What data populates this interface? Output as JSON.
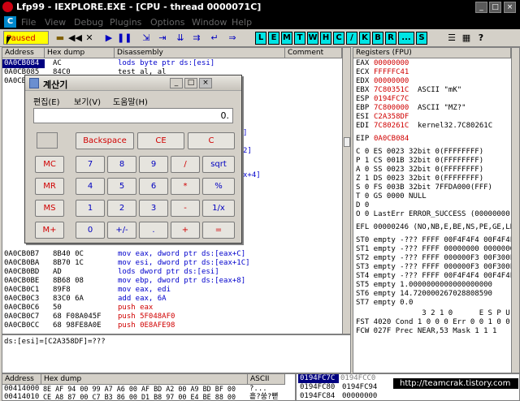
{
  "window": {
    "title": "Lfp99 - IEXPLORE.EXE - [CPU - thread 0000071C]",
    "min": "_",
    "max": "□",
    "close": "×"
  },
  "menu": [
    "File",
    "View",
    "Debug",
    "Plugins",
    "Options",
    "Window",
    "Help"
  ],
  "toolbar": {
    "status": "Paused",
    "letters": [
      "L",
      "E",
      "M",
      "T",
      "W",
      "H",
      "C",
      "/",
      "K",
      "B",
      "R",
      "...",
      "S"
    ]
  },
  "disasm": {
    "headers": [
      "Address",
      "Hex dump",
      "Disassembly",
      "Comment"
    ],
    "rows": [
      {
        "addr": "0A0CB084",
        "hex": "AC",
        "asm": "lods byte ptr ds:[esi]",
        "sel": true
      },
      {
        "addr": "0A0CB085",
        "hex": "84C0",
        "asm": "test al, al"
      },
      {
        "addr": "0A0CB0B7",
        "hex": "8B40 0C",
        "asm": "mov eax, dword ptr ds:[eax+C]"
      },
      {
        "addr": "0A0CB0BA",
        "hex": "8B70 1C",
        "asm": "mov esi, dword ptr ds:[eax+1C]"
      },
      {
        "addr": "0A0CB0BD",
        "hex": "AD",
        "asm": "lods dword ptr ds:[esi]"
      },
      {
        "addr": "0A0CB0BE",
        "hex": "8B68 08",
        "asm": "mov ebp, dword ptr ds:[eax+8]"
      },
      {
        "addr": "0A0CB0C1",
        "hex": "89F8",
        "asm": "mov eax, edi"
      },
      {
        "addr": "0A0CB0C3",
        "hex": "83C0 6A",
        "asm": "add eax, 6A"
      },
      {
        "addr": "0A0CB0C6",
        "hex": "50",
        "asm": "push eax"
      },
      {
        "addr": "0A0CB0C7",
        "hex": "68 F08A045F",
        "asm": "push 5F048AF0"
      },
      {
        "addr": "0A0CB0CC",
        "hex": "68 98FE8A0E",
        "asm": "push 0E8AFE98"
      }
    ],
    "fragments": [
      "]",
      "2]",
      "x+4]"
    ],
    "info": "ds:[esi]=[C2A358DF]=???"
  },
  "registers": {
    "header": "Registers (FPU)",
    "lines": [
      {
        "n": "EAX",
        "v": "00000000",
        "c": "",
        "red": true
      },
      {
        "n": "ECX",
        "v": "FFFFFC41",
        "c": "",
        "red": true
      },
      {
        "n": "EDX",
        "v": "00000000",
        "c": "",
        "red": true
      },
      {
        "n": "EBX",
        "v": "7C80351C",
        "c": "ASCII \"mK\"",
        "red": true
      },
      {
        "n": "ESP",
        "v": "0194FC7C",
        "c": "",
        "red": true
      },
      {
        "n": "EBP",
        "v": "7C800000",
        "c": "ASCII \"MZ?\"",
        "red": true
      },
      {
        "n": "ESI",
        "v": "C2A358DF",
        "c": "",
        "red": true
      },
      {
        "n": "EDI",
        "v": "7C80261C",
        "c": "kernel32.7C80261C",
        "red": true
      },
      {
        "n": "EIP",
        "v": "0A0CB084",
        "c": "",
        "red": true
      }
    ],
    "flags": [
      "C 0  ES 0023 32bit 0(FFFFFFFF)",
      "P 1  CS 001B 32bit 0(FFFFFFFF)",
      "A 0  SS 0023 32bit 0(FFFFFFFF)",
      "Z 1  DS 0023 32bit 0(FFFFFFFF)",
      "S 0  FS 003B 32bit 7FFDA000(FFF)",
      "T 0  GS 0000 NULL",
      "D 0",
      "O 0  LastErr ERROR_SUCCESS (00000000)"
    ],
    "efl": "EFL 00000246 (NO,NB,E,BE,NS,PE,GE,LE)",
    "fpu": [
      "ST0 empty -??? FFFF 00F4F4F4 00F4F4F4",
      "ST1 empty -??? FFFF 00000000 00000000",
      "ST2 empty -??? FFFF 000000F3 00F300F3",
      "ST3 empty -??? FFFF 000000F3 00F300F3",
      "ST4 empty -??? FFFF 00F4F4F4 00F4F4F4",
      "ST5 empty 1.0000000000000000000",
      "ST6 empty 14.720000267028808590",
      "ST7 empty 0.0"
    ],
    "fst_hdr": "               3 2 1 0      E S P U O",
    "fst": "FST 4020  Cond 1 0 0 0  Err 0 0 1 0 0",
    "fcw": "FCW 027F  Prec NEAR,53  Mask    1 1 1"
  },
  "dump": {
    "headers": [
      "Address",
      "Hex dump",
      "ASCII"
    ],
    "rows": [
      {
        "addr": "00414000",
        "hex": "8E AF 94 00 99 A7 A6 00 AF BD A2 00 A9 BD BF 00",
        "ascii": "?..."
      },
      {
        "addr": "00414010",
        "hex": "CE A8 87 00 C7 B3 86 00 D1 B8 97 00 E4 BE 88 00",
        "ascii": "흩?쑹?뼏"
      }
    ]
  },
  "stack": {
    "rows": [
      {
        "a": "0194FC7C",
        "v": "0194FCC0",
        "sel": true
      },
      {
        "a": "0194FC80",
        "v": "0194FC94"
      },
      {
        "a": "0194FC84",
        "v": "00000000"
      }
    ]
  },
  "watermark": "http://teamcrak.tistory.com",
  "calculator": {
    "title": "계산기",
    "menu": [
      "편집(E)",
      "보기(V)",
      "도움말(H)"
    ],
    "display": "0.",
    "backspace": "Backspace",
    "ce": "CE",
    "c": "C",
    "mem": [
      "MC",
      "MR",
      "MS",
      "M+"
    ],
    "keys": [
      [
        "7",
        "8",
        "9",
        "/",
        "sqrt"
      ],
      [
        "4",
        "5",
        "6",
        "*",
        "%"
      ],
      [
        "1",
        "2",
        "3",
        "-",
        "1/x"
      ],
      [
        "0",
        "+/-",
        ".",
        "+",
        "="
      ]
    ]
  }
}
